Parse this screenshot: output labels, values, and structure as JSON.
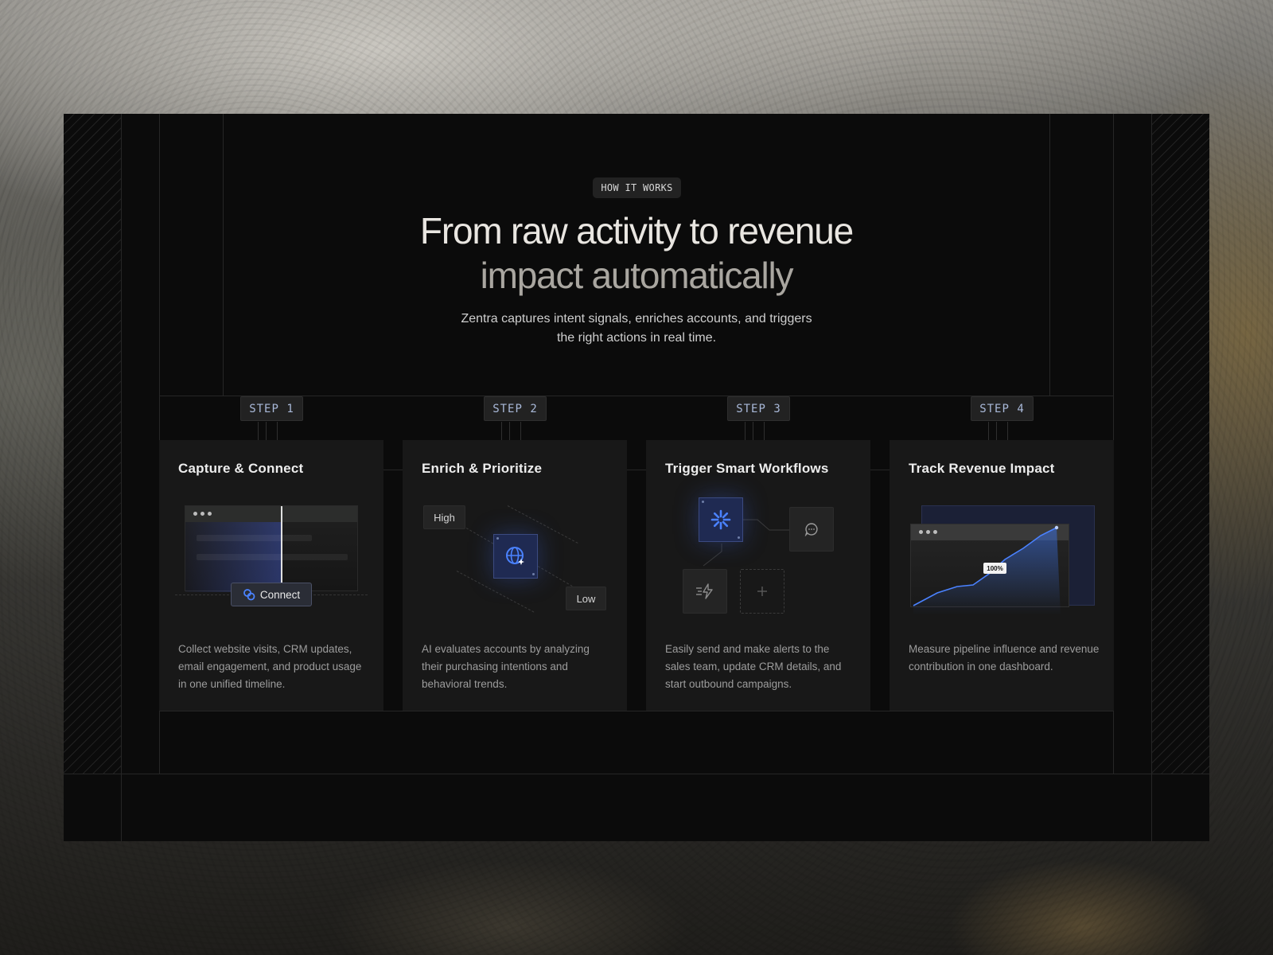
{
  "section": {
    "eyebrow": "HOW IT WORKS",
    "headline_line1": "From raw activity to revenue",
    "headline_line2": "impact automatically",
    "subtitle": "Zentra captures intent signals, enriches accounts, and triggers the right actions in real time."
  },
  "steps": [
    {
      "badge": "STEP 1",
      "title": "Capture & Connect",
      "description": "Collect website visits, CRM updates, email engagement, and product usage in one unified timeline.",
      "visual": {
        "button_label": "Connect",
        "icon": "link-icon"
      }
    },
    {
      "badge": "STEP 2",
      "title": "Enrich & Prioritize",
      "description": "AI evaluates accounts by analyzing their purchasing intentions and behavioral trends.",
      "visual": {
        "tag_high": "High",
        "tag_low": "Low",
        "icon": "globe-sparkle-icon"
      }
    },
    {
      "badge": "STEP 3",
      "title": "Trigger Smart Workflows",
      "description": "Easily send and make alerts to the sales team, update CRM details, and start outbound campaigns.",
      "visual": {
        "icons": [
          "loader-icon",
          "chat-icon",
          "bolt-icon",
          "plus-icon"
        ]
      }
    },
    {
      "badge": "STEP 4",
      "title": "Track Revenue Impact",
      "description": "Measure pipeline influence and revenue contribution in one dashboard.",
      "visual": {
        "percent_label": "100%"
      }
    }
  ],
  "colors": {
    "panel_bg": "#0b0b0b",
    "card_bg": "#181818",
    "accent_blue": "#3b6fe0",
    "badge_text": "#a9b9d9"
  }
}
